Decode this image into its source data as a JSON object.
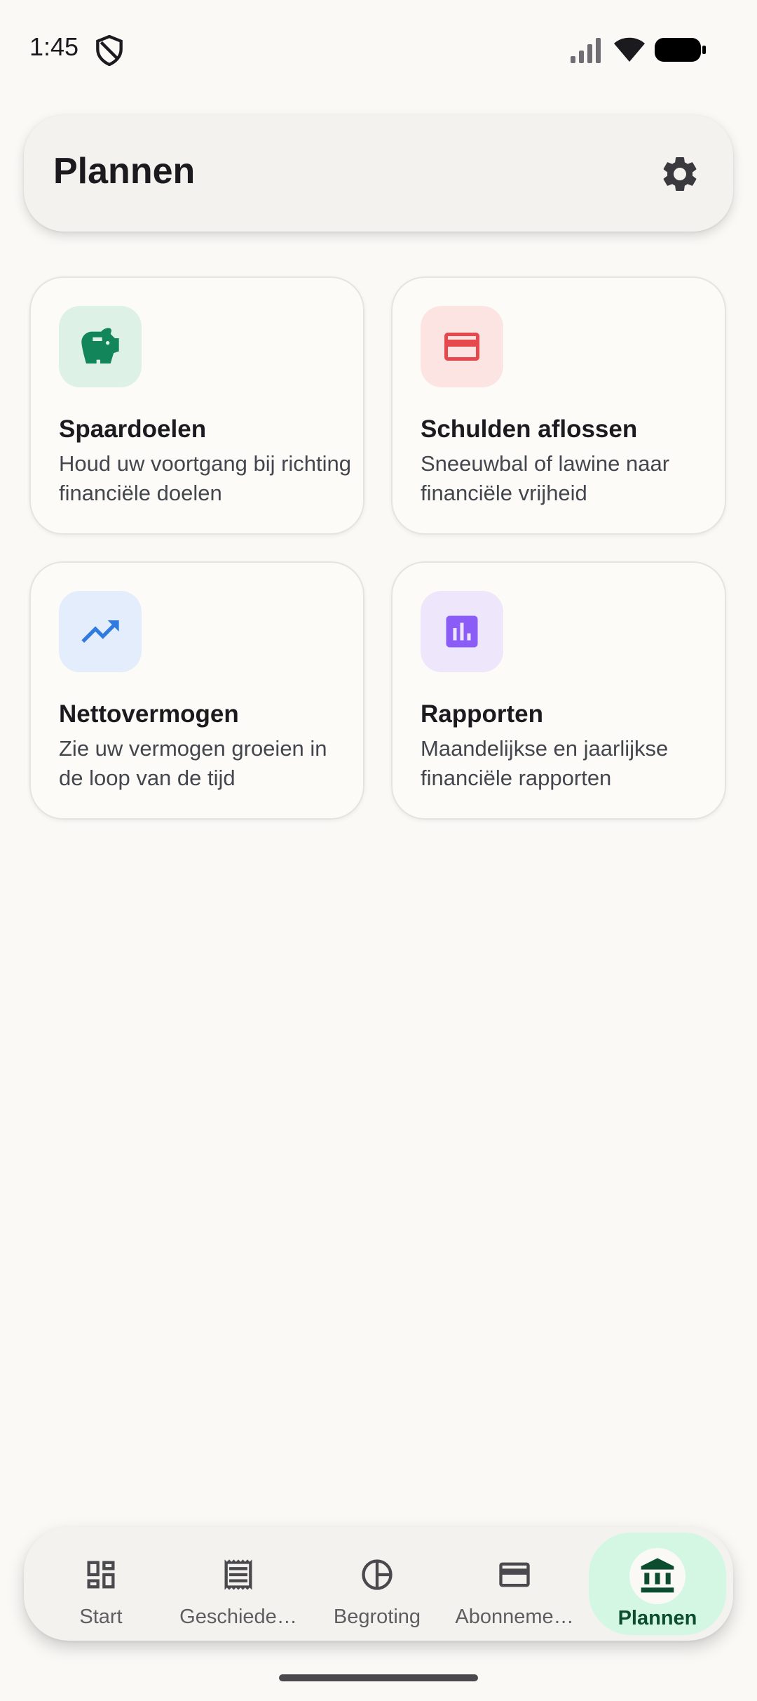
{
  "status_bar": {
    "time": "1:45"
  },
  "header": {
    "title": "Plannen"
  },
  "cards": [
    {
      "title": "Spaardoelen",
      "description": "Houd uw voortgang bij richting financiële doelen",
      "icon": "piggy-bank-icon",
      "icon_color": "#13855A",
      "icon_bg": "#DDF1E6"
    },
    {
      "title": "Schulden aflossen",
      "description": "Sneeuwbal of lawine naar financiële vrijheid",
      "icon": "credit-card-icon",
      "icon_color": "#E5484D",
      "icon_bg": "#FBE4E2"
    },
    {
      "title": "Nettovermogen",
      "description": "Zie uw vermogen groeien in de loop van de tijd",
      "icon": "trending-up-icon",
      "icon_color": "#2F7BE0",
      "icon_bg": "#E4EDFB"
    },
    {
      "title": "Rapporten",
      "description": "Maandelijkse en jaarlijkse financiële rapporten",
      "icon": "bar-chart-icon",
      "icon_color": "#8B5CF6",
      "icon_bg": "#EEE6FA"
    }
  ],
  "nav": {
    "items": [
      {
        "label": "Start",
        "icon": "dashboard-icon"
      },
      {
        "label": "Geschiede…",
        "icon": "receipt-icon"
      },
      {
        "label": "Begroting",
        "icon": "pie-chart-icon"
      },
      {
        "label": "Abonneme…",
        "icon": "credit-card-icon"
      },
      {
        "label": "Plannen",
        "icon": "bank-icon",
        "selected": true
      }
    ]
  },
  "colors": {
    "accent": "#0B4D2E",
    "nav_active_bg": "#D4F7E4",
    "background": "#FAF9F6"
  }
}
